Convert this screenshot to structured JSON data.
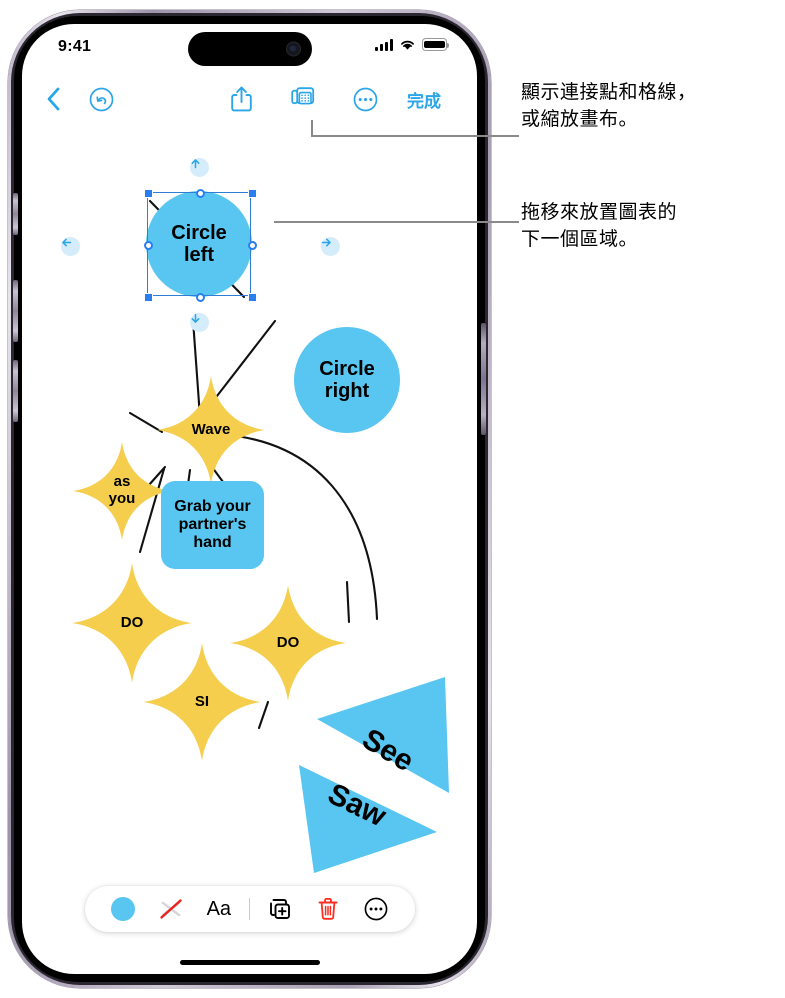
{
  "status_bar": {
    "time": "9:41",
    "signal_icon": "cellular-bars-icon",
    "wifi_icon": "wifi-icon",
    "battery_icon": "battery-full-icon"
  },
  "toolbar": {
    "back_icon": "chevron-left-icon",
    "undo_icon": "undo-circle-icon",
    "share_icon": "share-up-arrow-icon",
    "grid_icon": "canvas-grid-icon",
    "more_icon": "ellipsis-circle-icon",
    "done_label": "完成"
  },
  "canvas": {
    "shapes": [
      {
        "id": "circle-left",
        "label": "Circle left",
        "type": "circle",
        "color": "#58c6f0",
        "selected": true
      },
      {
        "id": "circle-right",
        "label": "Circle right",
        "type": "circle",
        "color": "#58c6f0",
        "selected": false
      },
      {
        "id": "star-wave",
        "label": "Wave",
        "type": "star",
        "color": "#f5ce4e",
        "selected": false
      },
      {
        "id": "star-as-you",
        "label": "as you",
        "type": "star",
        "color": "#f5ce4e",
        "selected": false
      },
      {
        "id": "rect-grab",
        "label": "Grab your partner's hand",
        "type": "rounded-rect",
        "color": "#58c6f0",
        "selected": false
      },
      {
        "id": "star-do-left",
        "label": "DO",
        "type": "star",
        "color": "#f5ce4e",
        "selected": false
      },
      {
        "id": "star-do-right",
        "label": "DO",
        "type": "star",
        "color": "#f5ce4e",
        "selected": false
      },
      {
        "id": "star-si",
        "label": "SI",
        "type": "star",
        "color": "#f5ce4e",
        "selected": false
      },
      {
        "id": "triangle-see",
        "label": "See",
        "type": "triangle",
        "color": "#58c6f0",
        "selected": false
      },
      {
        "id": "triangle-saw",
        "label": "Saw",
        "type": "triangle",
        "color": "#58c6f0",
        "selected": false
      }
    ],
    "selection": {
      "arrow_up": "arrow-up-icon",
      "arrow_down": "arrow-down-icon",
      "arrow_left": "arrow-left-icon",
      "arrow_right": "arrow-right-icon"
    }
  },
  "bottom_bar": {
    "fill_color": "#58c6f0",
    "fill_icon": "fill-color-swatch",
    "stroke_icon": "no-stroke-icon",
    "text_label": "Aa",
    "duplicate_icon": "duplicate-shape-icon",
    "delete_icon": "trash-icon",
    "more_icon": "ellipsis-circle-icon",
    "delete_color": "#ff3b30"
  },
  "callouts": [
    {
      "id": "callout-grid",
      "line1": "顯示連接點和格線，",
      "line2": "或縮放畫布。"
    },
    {
      "id": "callout-drag",
      "line1": "拖移來放置圖表的",
      "line2": "下一個區域。"
    }
  ],
  "colors": {
    "accent": "#2aa6e8",
    "shape_blue": "#58c6f0",
    "shape_yellow": "#f5ce4e",
    "selection_blue": "#2a7ff0",
    "leader_gray": "#8a8a8a"
  }
}
